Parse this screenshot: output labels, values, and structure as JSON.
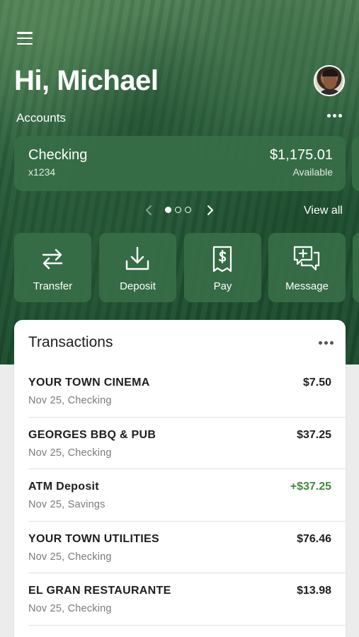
{
  "header": {
    "greeting": "Hi, Michael",
    "menu_icon": "hamburger-menu-icon",
    "avatar_icon": "user-avatar"
  },
  "accounts": {
    "label": "Accounts",
    "more_icon": "more-horizontal-icon",
    "cards": [
      {
        "name": "Checking",
        "number": "x1234",
        "balance": "$1,175.01",
        "balance_label": "Available"
      }
    ],
    "pager": {
      "total": 3,
      "active": 1
    },
    "view_all": "View all"
  },
  "actions": [
    {
      "label": "Transfer",
      "icon": "transfer-arrows-icon"
    },
    {
      "label": "Deposit",
      "icon": "download-tray-icon"
    },
    {
      "label": "Pay",
      "icon": "dollar-receipt-icon"
    },
    {
      "label": "Message",
      "icon": "chat-plus-icon"
    }
  ],
  "transactions": {
    "title": "Transactions",
    "items": [
      {
        "merchant": "YOUR TOWN CINEMA",
        "meta": "Nov 25, Checking",
        "amount": "$7.50",
        "credit": false
      },
      {
        "merchant": "GEORGES BBQ & PUB",
        "meta": "Nov 25, Checking",
        "amount": "$37.25",
        "credit": false
      },
      {
        "merchant": "ATM Deposit",
        "meta": "Nov 25, Savings",
        "amount": "+$37.25",
        "credit": true
      },
      {
        "merchant": "YOUR TOWN UTILITIES",
        "meta": "Nov 25, Checking",
        "amount": "$76.46",
        "credit": false
      },
      {
        "merchant": "EL GRAN RESTAURANTE",
        "meta": "Nov 25, Checking",
        "amount": "$13.98",
        "credit": false
      }
    ]
  },
  "colors": {
    "brand_green": "#376e46",
    "credit_green": "#3d8a3a"
  }
}
